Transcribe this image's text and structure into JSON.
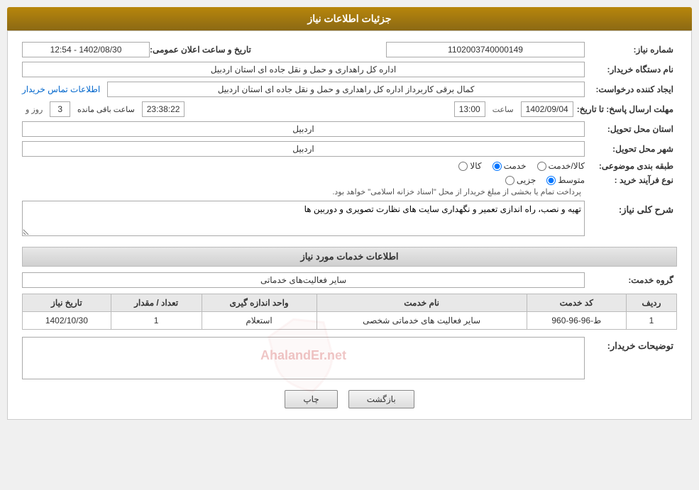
{
  "header": {
    "title": "جزئیات اطلاعات نیاز"
  },
  "fields": {
    "need_number_label": "شماره نیاز:",
    "need_number_value": "1102003740000149",
    "date_announce_label": "تاریخ و ساعت اعلان عمومی:",
    "date_announce_value": "1402/08/30 - 12:54",
    "buyer_org_label": "نام دستگاه خریدار:",
    "buyer_org_value": "اداره کل راهداری و حمل و نقل جاده ای استان اردبیل",
    "creator_label": "ایجاد کننده درخواست:",
    "creator_value": "کمال برقی کاربرداز اداره کل راهداری و حمل و نقل جاده ای استان اردبیل",
    "creator_link": "اطلاعات تماس خریدار",
    "deadline_label": "مهلت ارسال پاسخ: تا تاریخ:",
    "deadline_date": "1402/09/04",
    "deadline_time_label": "ساعت",
    "deadline_time": "13:00",
    "deadline_day_label": "روز و",
    "deadline_days": "3",
    "deadline_remaining_label": "ساعت باقی مانده",
    "deadline_remaining": "23:38:22",
    "province_label": "استان محل تحویل:",
    "province_value": "اردبیل",
    "city_label": "شهر محل تحویل:",
    "city_value": "اردبیل",
    "category_label": "طبقه بندی موضوعی:",
    "category_options": [
      {
        "id": "kala",
        "label": "کالا"
      },
      {
        "id": "khadamat",
        "label": "خدمت"
      },
      {
        "id": "kala_khadamat",
        "label": "کالا/خدمت"
      }
    ],
    "category_selected": "khadamat",
    "process_label": "نوع فرآیند خرید :",
    "process_options": [
      {
        "id": "jozei",
        "label": "جزیی"
      },
      {
        "id": "motavasset",
        "label": "متوسط"
      }
    ],
    "process_selected": "motavasset",
    "process_note": "پرداخت تمام یا بخشی از مبلغ خریدار از محل \"اسناد خزانه اسلامی\" خواهد بود.",
    "description_label": "شرح کلی نیاز:",
    "description_value": "تهیه و نصب، راه اندازی تعمیر و نگهداری سایت های نظارت تصویری و دوربین ها",
    "services_title": "اطلاعات خدمات مورد نیاز",
    "group_label": "گروه خدمت:",
    "group_value": "سایر فعالیت‌های خدماتی",
    "table": {
      "columns": [
        "ردیف",
        "کد خدمت",
        "نام خدمت",
        "واحد اندازه گیری",
        "تعداد / مقدار",
        "تاریخ نیاز"
      ],
      "rows": [
        {
          "row": "1",
          "code": "ط-96-96-960",
          "name": "سایر فعالیت های خدماتی شخصی",
          "unit": "استعلام",
          "quantity": "1",
          "date": "1402/10/30"
        }
      ]
    },
    "buyer_desc_label": "توضیحات خریدار:"
  },
  "actions": {
    "back_label": "بازگشت",
    "print_label": "چاپ"
  }
}
